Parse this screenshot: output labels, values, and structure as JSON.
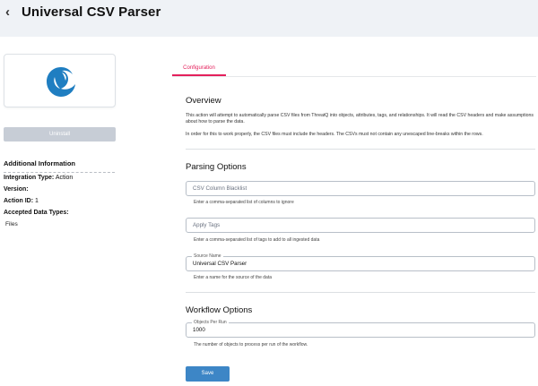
{
  "header": {
    "title": "Universal CSV Parser",
    "back_symbol": "‹"
  },
  "sidebar": {
    "uninstall_label": "Uninstall",
    "info_heading": "Additional Information",
    "integration_type_label": "Integration Type:",
    "integration_type_value": "Action",
    "version_label": "Version:",
    "action_id_label": "Action ID:",
    "action_id_value": "1",
    "accepted_types_label": "Accepted Data Types:",
    "accepted_types_value": "Files"
  },
  "tabs": [
    {
      "label": "Configuration",
      "active": true
    }
  ],
  "overview": {
    "title": "Overview",
    "p1": "This action will attempt to automatically parse CSV files from ThreatQ into objects, attributes, tags, and relationships. It will read the CSV headers and make assumptions about how to parse the data.",
    "p2": "In order for this to work properly, the CSV files must include the headers. The CSVs must not contain any unescaped line-breaks within the rows."
  },
  "parsing": {
    "title": "Parsing Options",
    "blacklist": {
      "placeholder": "CSV Column Blacklist",
      "helper": "Enter a comma-separated list of columns to ignore"
    },
    "apply_tags": {
      "placeholder": "Apply Tags",
      "helper": "Enter a comma-separated list of tags to add to all ingested data"
    },
    "source_name": {
      "label": "Source Name",
      "value": "Universal CSV Parser",
      "helper": "Enter a name for the source of the data"
    }
  },
  "workflow": {
    "title": "Workflow Options",
    "objects_per_run": {
      "label": "Objects Per Run",
      "value": "1000",
      "helper": "The number of objects to process per run of the workflow."
    }
  },
  "save_label": "Save",
  "colors": {
    "accent": "#e4205c",
    "primary": "#3d86c6",
    "header_bg": "#eff2f6",
    "disabled": "#c7cdd6"
  }
}
